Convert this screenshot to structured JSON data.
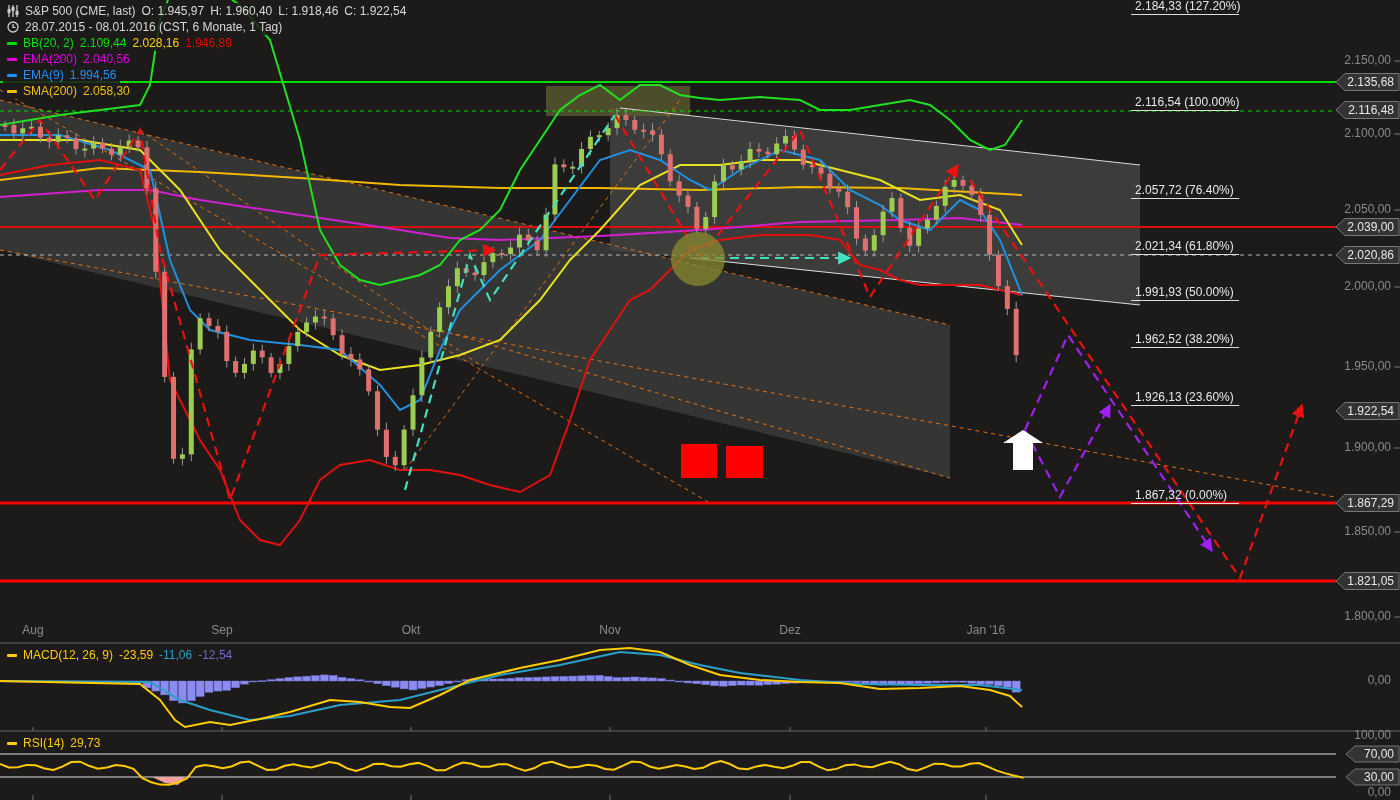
{
  "header": {
    "title": "S&P 500 (CME, last)",
    "ohlc": [
      "O: 1.945,97",
      "H: 1.960,40",
      "L: 1.918,46",
      "C: 1.922,54"
    ],
    "range": "28.07.2015 - 08.01.2016 (CST, 6 Monate, 1 Tag)"
  },
  "legend": [
    {
      "label": "BB(20, 2)",
      "color": "#00e000",
      "values": [
        {
          "text": "2.109,44",
          "color": "#00e000"
        },
        {
          "text": "2.028,16",
          "color": "#ffd000"
        },
        {
          "text": "1.946,89",
          "color": "#e00000"
        }
      ]
    },
    {
      "label": "EMA(200)",
      "color": "#e000e0",
      "values": [
        {
          "text": "2.040,56",
          "color": "#e000e0"
        }
      ]
    },
    {
      "label": "EMA(9)",
      "color": "#1e90ff",
      "values": [
        {
          "text": "1.994,56",
          "color": "#1e90ff"
        }
      ]
    },
    {
      "label": "SMA(200)",
      "color": "#f0c000",
      "values": [
        {
          "text": "2.058,30",
          "color": "#f0c000"
        }
      ]
    }
  ],
  "fib_levels": [
    "2.184,33 (127.20%)",
    "2.116,54 (100.00%)",
    "2.057,72 (76.40%)",
    "2.021,34 (61.80%)",
    "1.991,93 (50.00%)",
    "1.962,52 (38.20%)",
    "1.926,13 (23.60%)",
    "1.867,32 (0.00%)"
  ],
  "price_axis": [
    "2.150,00",
    "2.100,00",
    "2.050,00",
    "2.000,00",
    "1.950,00",
    "1.900,00",
    "1.850,00",
    "1.800,00"
  ],
  "price_tags": [
    "2.135,68",
    "2.116,48",
    "2.039,00",
    "2.020,86",
    "1.922,54",
    "1.867,29",
    "1.821,05"
  ],
  "time_axis": [
    "Aug",
    "Sep",
    "Okt",
    "Nov",
    "Dez",
    "Jan '16"
  ],
  "macd": {
    "legend": {
      "label": "MACD(12, 26, 9)",
      "color": "#ffcc00",
      "values": [
        {
          "text": "-23,59",
          "color": "#ffcc00"
        },
        {
          "text": "-11,06",
          "color": "#2aa0c8"
        },
        {
          "text": "-12,54",
          "color": "#6a6ad0"
        }
      ]
    },
    "axis": [
      "0,00"
    ]
  },
  "rsi": {
    "legend": {
      "label": "RSI(14)",
      "color": "#ffcc00",
      "values": [
        {
          "text": "29,73",
          "color": "#ffcc00"
        }
      ]
    },
    "axis": [
      "100,00",
      "0,00"
    ],
    "tags": [
      "70,00",
      "30,00"
    ]
  }
}
